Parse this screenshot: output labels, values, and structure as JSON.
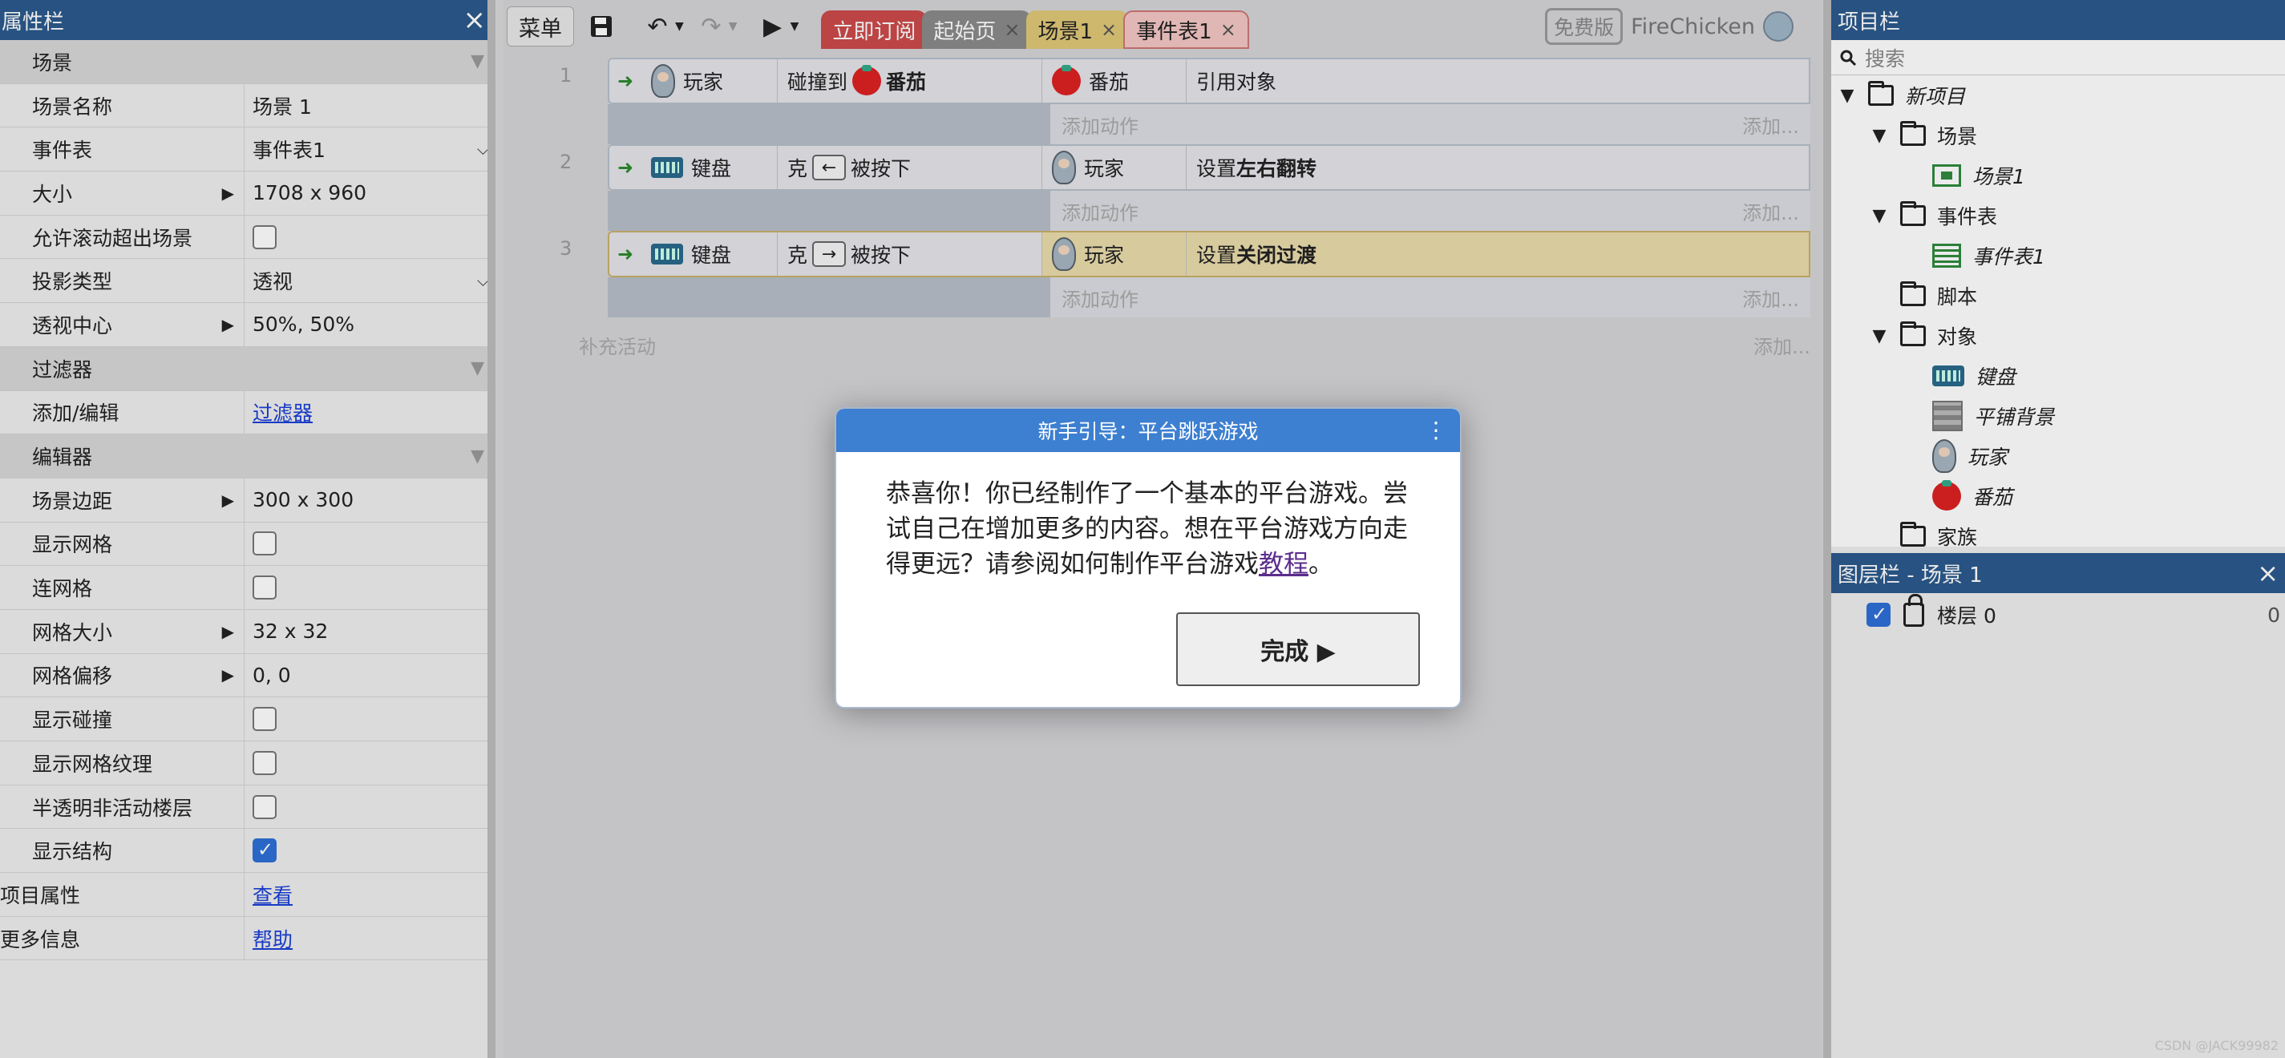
{
  "properties": {
    "title": "属性栏",
    "close": "×",
    "rows": [
      {
        "type": "group",
        "label": "场景"
      },
      {
        "label": "场景名称",
        "value": "场景 1"
      },
      {
        "label": "事件表",
        "value": "事件表1",
        "control": "select"
      },
      {
        "label": "大小",
        "value": "1708 x 960",
        "expandable": true
      },
      {
        "label": "允许滚动超出场景",
        "control": "checkbox",
        "checked": false
      },
      {
        "label": "投影类型",
        "value": "透视",
        "control": "select"
      },
      {
        "label": "透视中心",
        "value": "50%, 50%",
        "expandable": true
      },
      {
        "type": "group",
        "label": "过滤器"
      },
      {
        "label": "添加/编辑",
        "link": "过滤器"
      },
      {
        "type": "group",
        "label": "编辑器"
      },
      {
        "label": "场景边距",
        "value": "300 x 300",
        "expandable": true
      },
      {
        "label": "显示网格",
        "control": "checkbox",
        "checked": false
      },
      {
        "label": "连网格",
        "control": "checkbox",
        "checked": false
      },
      {
        "label": "网格大小",
        "value": "32 x 32",
        "expandable": true
      },
      {
        "label": "网格偏移",
        "value": "0, 0",
        "expandable": true
      },
      {
        "label": "显示碰撞",
        "control": "checkbox",
        "checked": false
      },
      {
        "label": "显示网格纹理",
        "control": "checkbox",
        "checked": false
      },
      {
        "label": "半透明非活动楼层",
        "control": "checkbox",
        "checked": false
      },
      {
        "label": "显示结构",
        "control": "checkbox",
        "checked": true
      },
      {
        "label": "项目属性",
        "link": "查看",
        "wide": true
      },
      {
        "label": "更多信息",
        "link": "帮助",
        "wide": true
      }
    ]
  },
  "toolbar": {
    "menu": "菜单",
    "save_icon": "floppy-icon",
    "undo_icon": "undo-icon",
    "redo_icon": "redo-icon",
    "play_icon": "play-icon",
    "tabs": [
      {
        "label": "立即订阅",
        "kind": "sub"
      },
      {
        "label": "起始页",
        "kind": "start",
        "closable": true
      },
      {
        "label": "场景1",
        "kind": "scene",
        "closable": true
      },
      {
        "label": "事件表1",
        "kind": "events",
        "closable": true
      }
    ],
    "edition": "免费版",
    "user": "FireChicken"
  },
  "events": [
    {
      "num": "1",
      "condition_object": "玩家",
      "condition_prefix": "碰撞到",
      "condition_target": "番茄",
      "action_object": "番茄",
      "action": "引用对象",
      "add_action": "添加动作",
      "add": "添加..."
    },
    {
      "num": "2",
      "condition_object": "键盘",
      "condition_prefix": "克",
      "condition_key": "←",
      "condition_suffix": "被按下",
      "action_object": "玩家",
      "action_prefix": "设置",
      "action_bold": "左右翻转",
      "add_action": "添加动作",
      "add": "添加..."
    },
    {
      "num": "3",
      "condition_object": "键盘",
      "condition_prefix": "克",
      "condition_key": "→",
      "condition_suffix": "被按下",
      "action_object": "玩家",
      "action_prefix": "设置",
      "action_bold": "关闭过渡",
      "add_action": "添加动作",
      "add": "添加..."
    }
  ],
  "supplement": {
    "label": "补充活动",
    "add": "添加..."
  },
  "dialog": {
    "title": "新手引导：平台跳跃游戏",
    "text_before": "恭喜你！你已经制作了一个基本的平台游戏。尝试自己在增加更多的内容。想在平台游戏方向走得更远？请参阅如何制作平台游戏",
    "link": "教程",
    "text_after": "。",
    "done": "完成 ▶"
  },
  "project": {
    "title": "项目栏",
    "search_placeholder": "搜索",
    "tree": [
      {
        "label": "新项目",
        "level": 0,
        "icon": "folder",
        "arrow": "▼",
        "italic": true
      },
      {
        "label": "场景",
        "level": 1,
        "icon": "folder",
        "arrow": "▼"
      },
      {
        "label": "场景1",
        "level": 2,
        "icon": "scene",
        "italic": true
      },
      {
        "label": "事件表",
        "level": 1,
        "icon": "folder",
        "arrow": "▼"
      },
      {
        "label": "事件表1",
        "level": 2,
        "icon": "list",
        "italic": true
      },
      {
        "label": "脚本",
        "level": 1,
        "icon": "folder"
      },
      {
        "label": "对象",
        "level": 1,
        "icon": "folder",
        "arrow": "▼"
      },
      {
        "label": "键盘",
        "level": 2,
        "icon": "keyboard",
        "italic": true
      },
      {
        "label": "平铺背景",
        "level": 2,
        "icon": "tiled",
        "italic": true
      },
      {
        "label": "玩家",
        "level": 2,
        "icon": "player",
        "italic": true
      },
      {
        "label": "番茄",
        "level": 2,
        "icon": "tomato",
        "italic": true
      },
      {
        "label": "家族",
        "level": 1,
        "icon": "family"
      }
    ]
  },
  "layers": {
    "title": "图层栏 - 场景 1",
    "items": [
      {
        "label": "楼层 0",
        "num": "0",
        "visible": true
      }
    ]
  },
  "watermark": "CSDN @JACK99982"
}
